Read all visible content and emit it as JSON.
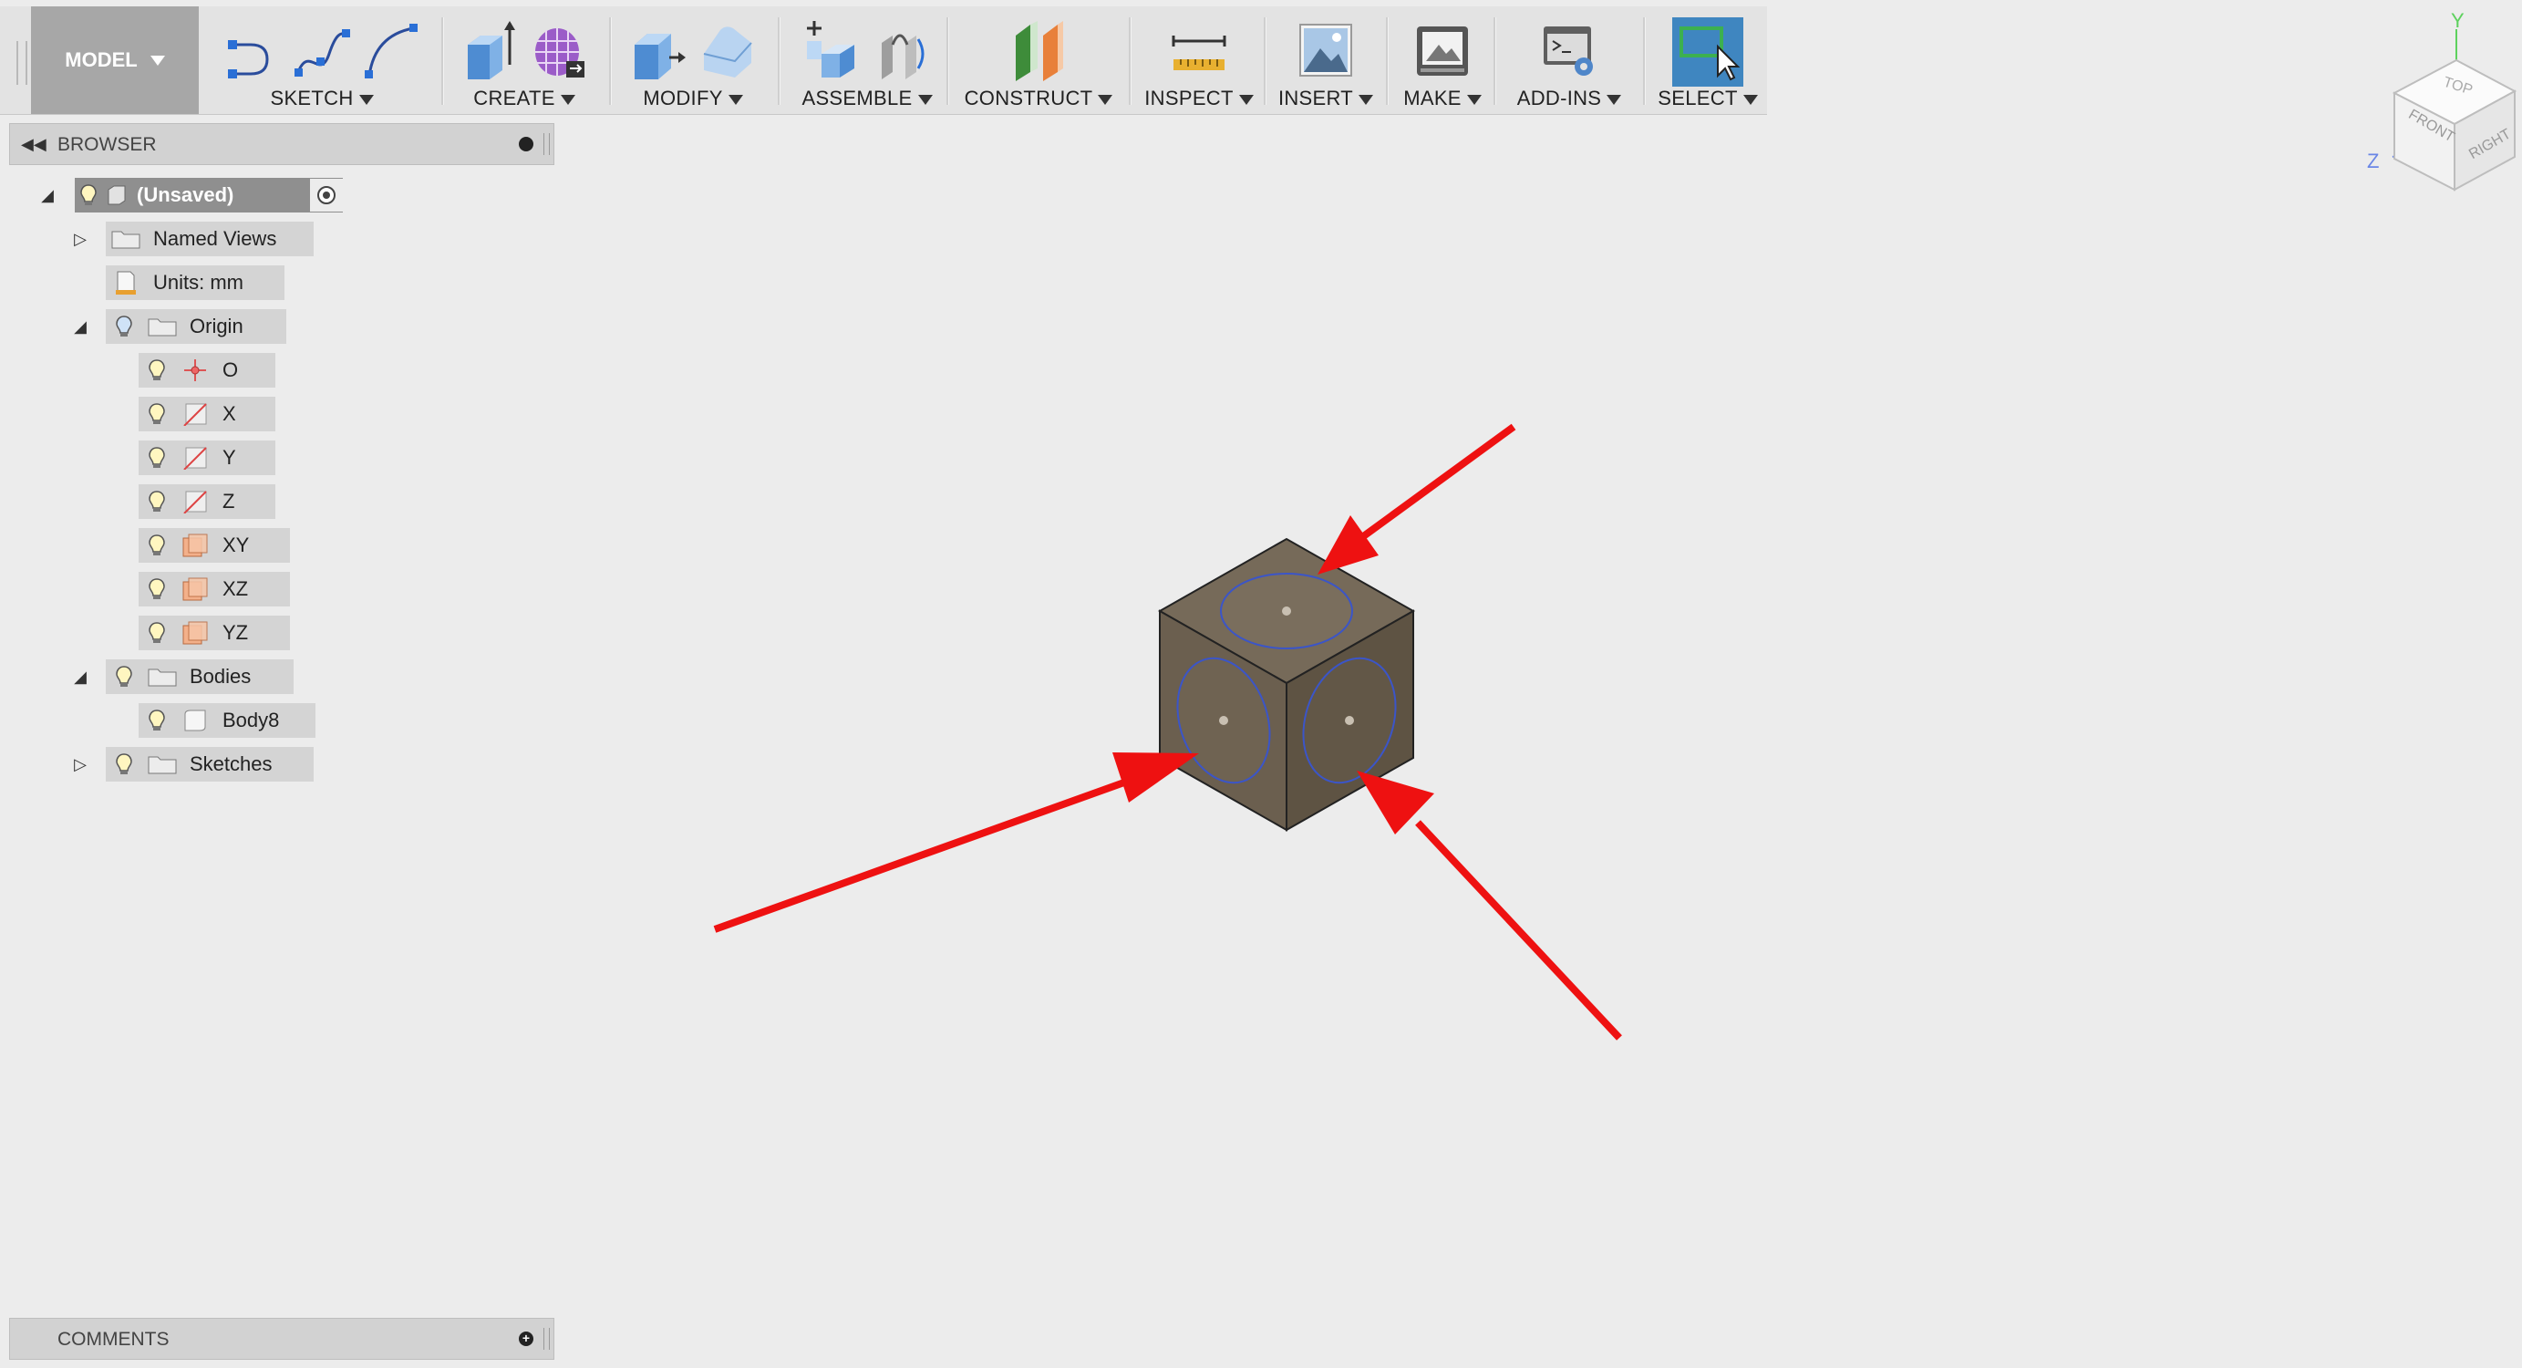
{
  "toolbar": {
    "workspace": "MODEL",
    "groups": {
      "sketch": "SKETCH",
      "create": "CREATE",
      "modify": "MODIFY",
      "assemble": "ASSEMBLE",
      "construct": "CONSTRUCT",
      "inspect": "INSPECT",
      "insert": "INSERT",
      "make": "MAKE",
      "addins": "ADD-INS",
      "select": "SELECT"
    }
  },
  "browser": {
    "title": "BROWSER",
    "root": "(Unsaved)",
    "named_views": "Named Views",
    "units": "Units: mm",
    "origin": "Origin",
    "origin_items": [
      "O",
      "X",
      "Y",
      "Z",
      "XY",
      "XZ",
      "YZ"
    ],
    "bodies": "Bodies",
    "body_items": [
      "Body8"
    ],
    "sketches": "Sketches"
  },
  "comments": {
    "title": "COMMENTS"
  },
  "viewcube": {
    "faces": [
      "TOP",
      "FRONT",
      "RIGHT"
    ],
    "axes": [
      "Y",
      "Z"
    ]
  },
  "colors": {
    "toolbar_bg": "#e3e3e3",
    "workspace_btn": "#a7a7a7",
    "select_accent": "#3f86c0",
    "cube_top": "#766a59",
    "cube_left": "#6b5f4f",
    "cube_right": "#5e5343",
    "hole_outline": "#3b55c8",
    "annotation_arrow": "#ee1111"
  }
}
